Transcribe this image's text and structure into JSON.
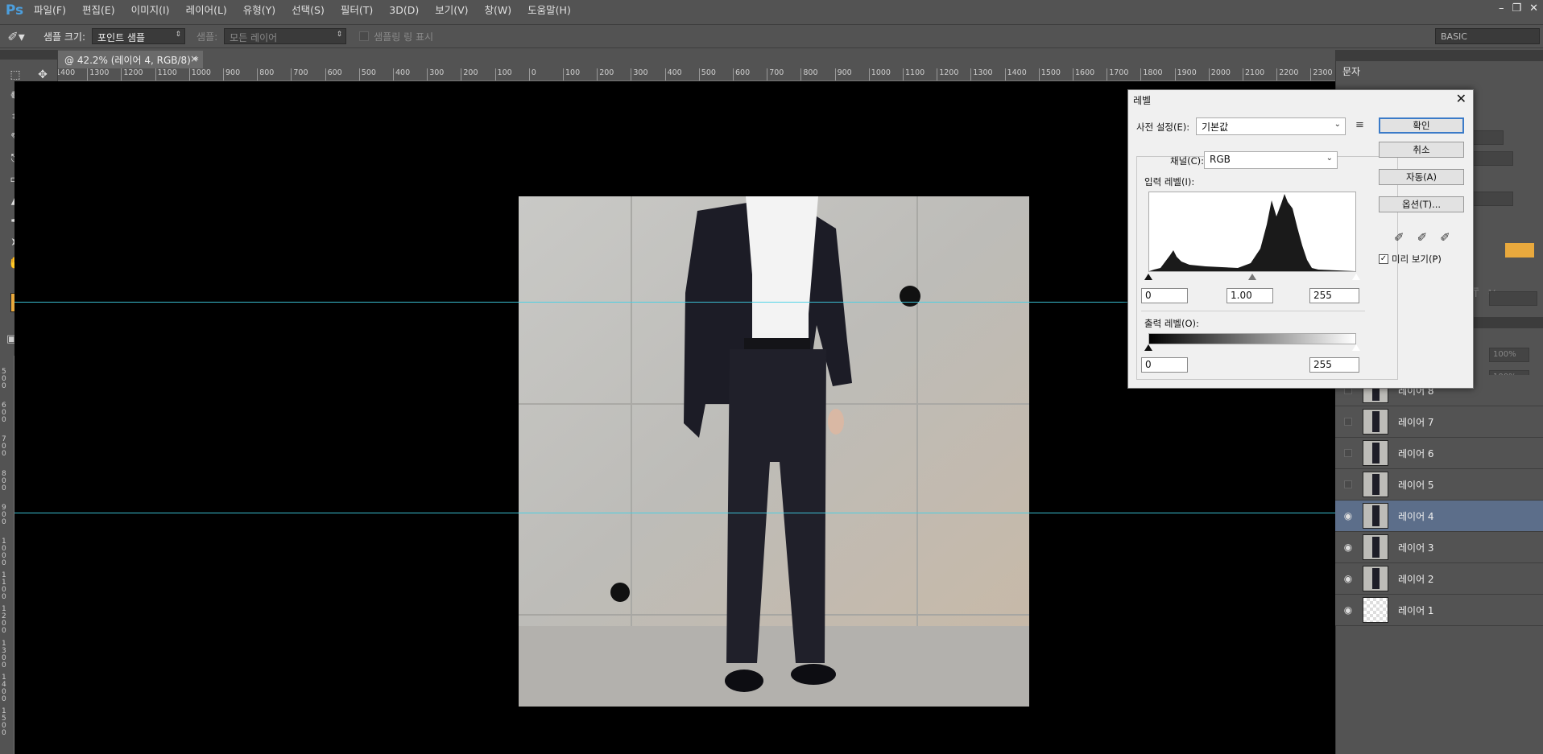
{
  "app": {
    "logo": "Ps"
  },
  "menu": [
    "파일(F)",
    "편집(E)",
    "이미지(I)",
    "레이어(L)",
    "유형(Y)",
    "선택(S)",
    "필터(T)",
    "3D(D)",
    "보기(V)",
    "창(W)",
    "도움말(H)"
  ],
  "options": {
    "sample_size_label": "샘플 크기:",
    "sample_size_value": "포인트 샘플",
    "sample_label": "샘플:",
    "sample_value": "모든 레이어",
    "sampling_ring_label": "샘플링 링 표시",
    "workspace": "BASIC"
  },
  "document_tab": {
    "title": "@ 42.2% (레이어 4, RGB/8) *",
    "close": "×"
  },
  "ruler": {
    "h_ticks": [
      "1400",
      "1300",
      "1200",
      "1100",
      "1000",
      "900",
      "800",
      "700",
      "600",
      "500",
      "400",
      "300",
      "200",
      "100",
      "0",
      "100",
      "200",
      "300",
      "400",
      "500",
      "600",
      "700",
      "800",
      "900",
      "1000",
      "1100",
      "1200",
      "1300",
      "1400",
      "1500",
      "1600",
      "1700",
      "1800",
      "1900",
      "2000",
      "2100",
      "2200",
      "2300"
    ],
    "v_ticks": [
      "500",
      "600",
      "700",
      "800",
      "900",
      "1000",
      "1100",
      "1200",
      "1300",
      "1400",
      "1500"
    ]
  },
  "right_panel": {
    "tab_label": "문자"
  },
  "layers": [
    {
      "name": "레이어 8",
      "visible": false,
      "selected": false
    },
    {
      "name": "레이어 7",
      "visible": false,
      "selected": false
    },
    {
      "name": "레이어 6",
      "visible": false,
      "selected": false
    },
    {
      "name": "레이어 5",
      "visible": false,
      "selected": false
    },
    {
      "name": "레이어 4",
      "visible": true,
      "selected": true
    },
    {
      "name": "레이어 3",
      "visible": true,
      "selected": false
    },
    {
      "name": "레이어 2",
      "visible": true,
      "selected": false
    },
    {
      "name": "레이어 1",
      "visible": true,
      "selected": false
    }
  ],
  "levels_dialog": {
    "title": "레벨",
    "preset_label": "사전 설정(E):",
    "preset_value": "기본값",
    "channel_label": "채널(C):",
    "channel_value": "RGB",
    "input_label": "입력 레벨(I):",
    "input_black": "0",
    "input_gamma": "1.00",
    "input_white": "255",
    "output_label": "출력 레벨(O):",
    "output_black": "0",
    "output_white": "255",
    "ok_button": "확인",
    "cancel_button": "취소",
    "auto_button": "자동(A)",
    "options_button": "옵션(T)...",
    "preview_label": "미리 보기(P)",
    "preview_checked": true
  },
  "colors": {
    "foreground": "#e9a93d",
    "background": "#222222",
    "guide": "#3fd0e6",
    "selected_layer": "#5c6e8a"
  }
}
